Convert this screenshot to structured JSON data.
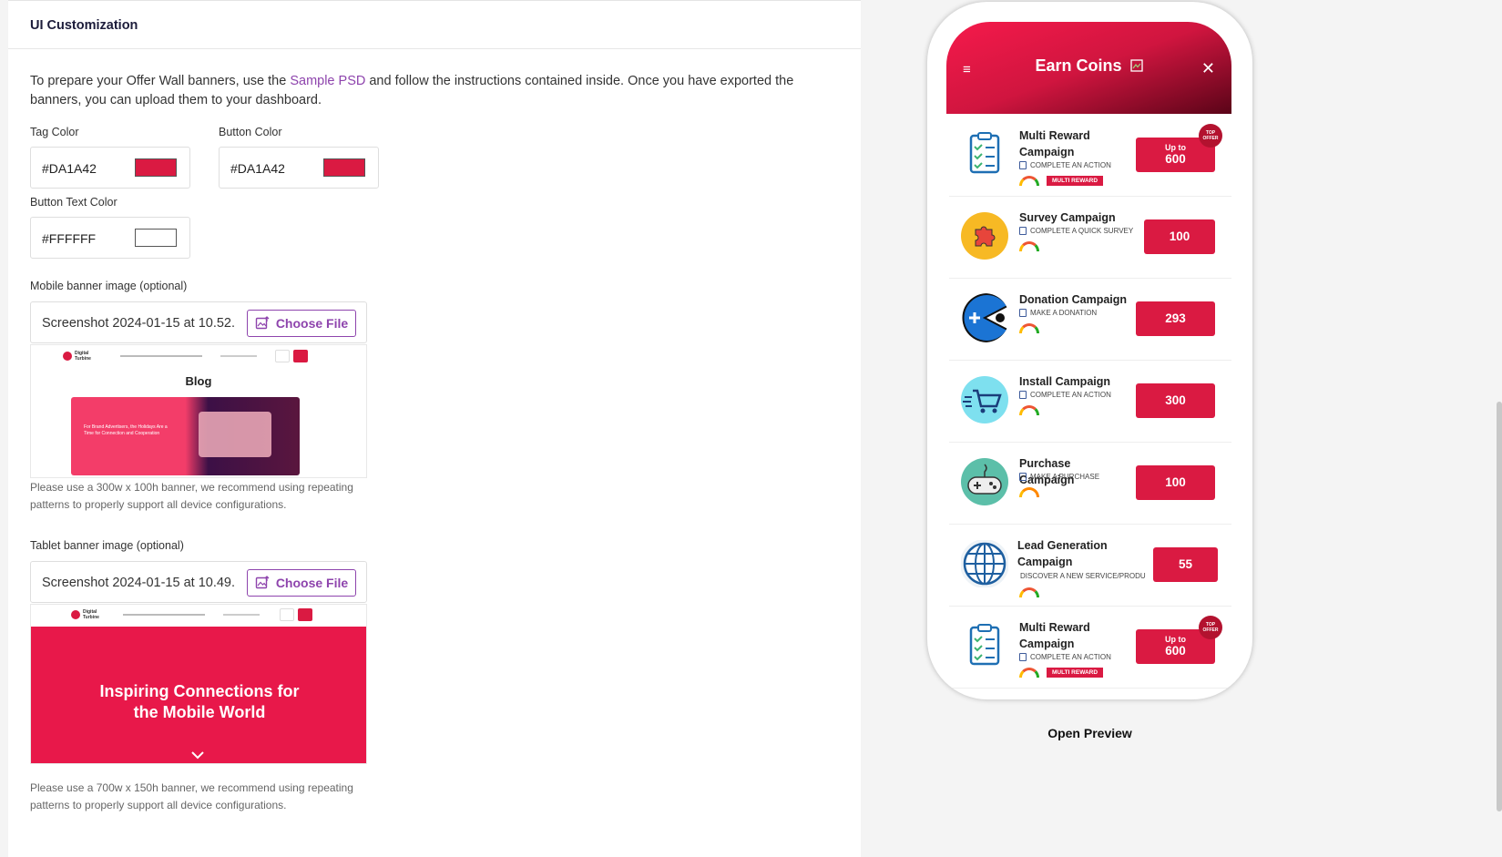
{
  "section": {
    "title": "UI Customization"
  },
  "intro": {
    "before": "To prepare your Offer Wall banners, use the ",
    "link": "Sample PSD",
    "after": " and follow the instructions contained inside. Once you have exported the banners, you can upload them to your dashboard."
  },
  "colors": {
    "tag": {
      "label": "Tag Color",
      "value": "#DA1A42",
      "swatch": "#DA1A42"
    },
    "button": {
      "label": "Button Color",
      "value": "#DA1A42",
      "swatch": "#DA1A42"
    },
    "button_text": {
      "label": "Button Text Color",
      "value": "#FFFFFF",
      "swatch": "#FFFFFF"
    }
  },
  "mobile_banner": {
    "label": "Mobile banner image (optional)",
    "filename": "Screenshot 2024-01-15 at 10.52.",
    "choose": "Choose File",
    "preview_logo": "Digital Turbine",
    "preview_heading": "Blog",
    "preview_card_text": "For Brand Advertisers, the Holidays Are a Time for Connection and Cooperation",
    "hint": "Please use a 300w x 100h banner, we recommend using repeating patterns to properly support all device configurations."
  },
  "tablet_banner": {
    "label": "Tablet banner image (optional)",
    "filename": "Screenshot 2024-01-15 at 10.49.",
    "choose": "Choose File",
    "preview_logo": "Digital Turbine",
    "preview_heading": "Inspiring Connections for the Mobile World",
    "hint": "Please use a 700w x 150h banner, we recommend using repeating patterns to properly support all device configurations."
  },
  "phone": {
    "title": "Earn Coins",
    "offers": [
      {
        "title": "Multi Reward Campaign",
        "sub": "COMPLETE AN ACTION",
        "tag": "MULTI REWARD",
        "upto": "Up to",
        "amount": "600",
        "top_offer": "TOP OFFER",
        "icon": "clipboard-icon"
      },
      {
        "title": "Survey Campaign",
        "sub": "COMPLETE A QUICK SURVEY",
        "amount": "100",
        "icon": "puzzle-icon"
      },
      {
        "title": "Donation Campaign",
        "sub": "MAKE A DONATION",
        "amount": "293",
        "icon": "pacman-icon"
      },
      {
        "title": "Install Campaign",
        "sub": "COMPLETE AN ACTION",
        "amount": "300",
        "icon": "cart-icon"
      },
      {
        "title": "Purchase Campaign",
        "sub": "MAKE A PURCHASE",
        "amount": "100",
        "icon": "gamepad-icon"
      },
      {
        "title": "Lead Generation Campaign",
        "sub": "DISCOVER A NEW SERVICE/PRODU",
        "amount": "55",
        "icon": "globe-icon"
      },
      {
        "title": "Multi Reward Campaign",
        "sub": "COMPLETE AN ACTION",
        "tag": "MULTI REWARD",
        "upto": "Up to",
        "amount": "600",
        "top_offer": "TOP OFFER",
        "icon": "clipboard-icon"
      }
    ]
  },
  "preview_link": "Open Preview",
  "accent": "#DA1A42",
  "link_color": "#8E44AD"
}
